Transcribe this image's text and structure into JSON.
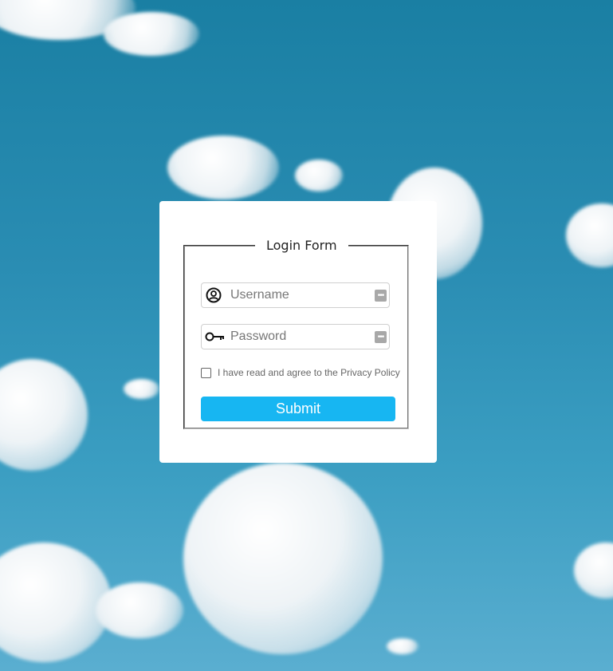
{
  "form": {
    "legend": "Login Form",
    "username_placeholder": "Username",
    "password_placeholder": "Password",
    "consent_label": "I have read and agree to the Privacy Policy",
    "consent_checked": false,
    "submit_label": "Submit"
  },
  "icons": {
    "username": "user-circle-icon",
    "password": "key-icon",
    "field_autofill": "dots-keyboard-icon"
  },
  "colors": {
    "submit_background": "#17b6f2",
    "sky": "#1a7fa3",
    "card_background": "#ffffff"
  }
}
